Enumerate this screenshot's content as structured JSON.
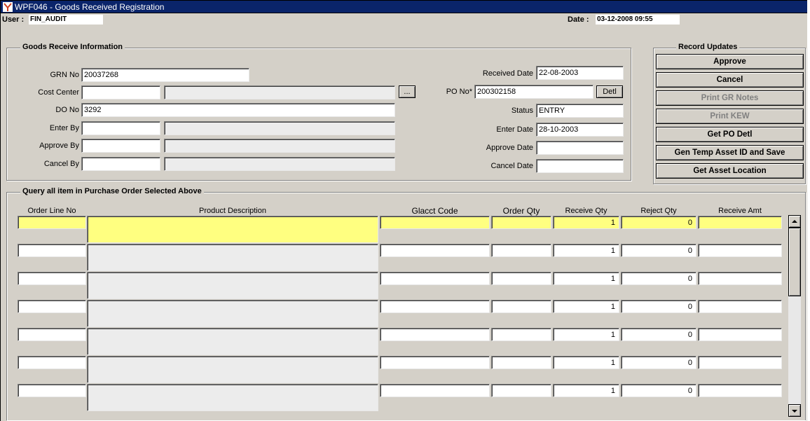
{
  "window": {
    "title": "WPF046 - Goods Received Registration"
  },
  "header": {
    "user_label": "User :",
    "user_value": "FIN_AUDIT",
    "date_label": "Date :",
    "date_value": "03-12-2008 09:55"
  },
  "goods_receive": {
    "legend": "Goods Receive Information",
    "grn_no_label": "GRN No",
    "grn_no": "20037268",
    "cost_center_label": "Cost Center",
    "cost_center_code": "",
    "cost_center_name": "",
    "lookup_label": "...",
    "do_no_label": "DO No",
    "do_no": "3292",
    "enter_by_label": "Enter By",
    "enter_by_code": "",
    "enter_by_name": "",
    "approve_by_label": "Approve By",
    "approve_by_code": "",
    "approve_by_name": "",
    "cancel_by_label": "Cancel By",
    "cancel_by_code": "",
    "cancel_by_name": "",
    "received_date_label": "Received Date",
    "received_date": "22-08-2003",
    "po_no_label": "PO No*",
    "po_no": "200302158",
    "po_detl_label": "Detl",
    "status_label": "Status",
    "status": "ENTRY",
    "enter_date_label": "Enter Date",
    "enter_date": "28-10-2003",
    "approve_date_label": "Approve Date",
    "approve_date": "",
    "cancel_date_label": "Cancel Date",
    "cancel_date": ""
  },
  "record_updates": {
    "legend": "Record Updates",
    "buttons": [
      {
        "label": "Approve",
        "enabled": true
      },
      {
        "label": "Cancel",
        "enabled": true
      },
      {
        "label": "Print GR Notes",
        "enabled": false
      },
      {
        "label": "Print KEW",
        "enabled": false
      },
      {
        "label": "Get PO Detl",
        "enabled": true
      },
      {
        "label": "Gen Temp Asset ID and Save",
        "enabled": true
      },
      {
        "label": "Get Asset Location",
        "enabled": true
      }
    ]
  },
  "query": {
    "legend": "Query all item in Purchase Order Selected Above",
    "columns": [
      "Order Line No",
      "Product Description",
      "Glacct Code",
      "Order Qty",
      "Receive Qty",
      "Reject Qty",
      "Receive Amt"
    ],
    "rows": [
      {
        "order_line_no": "",
        "product_description": "",
        "glacct_code": "",
        "order_qty": "",
        "receive_qty": "1",
        "reject_qty": "0",
        "receive_amt": ""
      },
      {
        "order_line_no": "",
        "product_description": "",
        "glacct_code": "",
        "order_qty": "",
        "receive_qty": "1",
        "reject_qty": "0",
        "receive_amt": ""
      },
      {
        "order_line_no": "",
        "product_description": "",
        "glacct_code": "",
        "order_qty": "",
        "receive_qty": "1",
        "reject_qty": "0",
        "receive_amt": ""
      },
      {
        "order_line_no": "",
        "product_description": "",
        "glacct_code": "",
        "order_qty": "",
        "receive_qty": "1",
        "reject_qty": "0",
        "receive_amt": ""
      },
      {
        "order_line_no": "",
        "product_description": "",
        "glacct_code": "",
        "order_qty": "",
        "receive_qty": "1",
        "reject_qty": "0",
        "receive_amt": ""
      },
      {
        "order_line_no": "",
        "product_description": "",
        "glacct_code": "",
        "order_qty": "",
        "receive_qty": "1",
        "reject_qty": "0",
        "receive_amt": ""
      },
      {
        "order_line_no": "",
        "product_description": "",
        "glacct_code": "",
        "order_qty": "",
        "receive_qty": "1",
        "reject_qty": "0",
        "receive_amt": ""
      }
    ]
  },
  "colors": {
    "title_bar": "#0a246a",
    "window_bg": "#d4d0c8",
    "current_row": "#ffff80",
    "readonly_field": "#ececec"
  }
}
